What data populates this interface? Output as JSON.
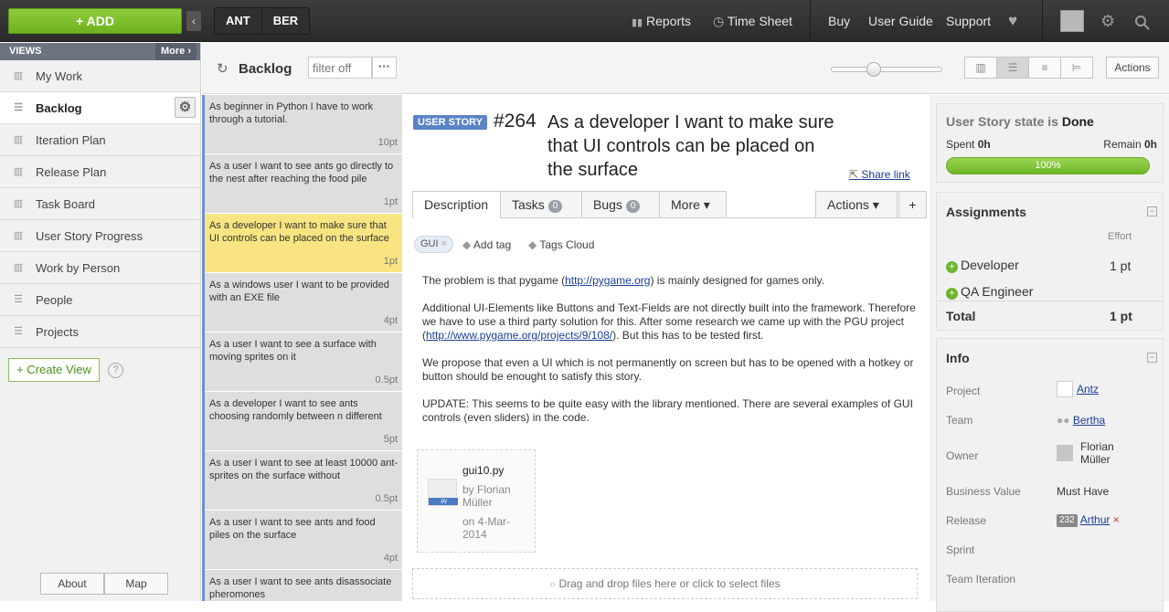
{
  "topbar": {
    "add_label": "+ ADD",
    "teams": [
      "ANT",
      "BER"
    ],
    "nav": {
      "reports": "Reports",
      "timesheet": "Time Sheet",
      "buy": "Buy",
      "user_guide": "User Guide",
      "support": "Support"
    }
  },
  "sidebar": {
    "views_label": "VIEWS",
    "more_label": "More ›",
    "items": [
      {
        "label": "My Work"
      },
      {
        "label": "Backlog"
      },
      {
        "label": "Iteration Plan"
      },
      {
        "label": "Release Plan"
      },
      {
        "label": "Task Board"
      },
      {
        "label": "User Story Progress"
      },
      {
        "label": "Work by Person"
      },
      {
        "label": "People"
      },
      {
        "label": "Projects"
      }
    ],
    "create_view": "+ Create View",
    "help": "?",
    "about": "About",
    "map": "Map"
  },
  "toolbar": {
    "title": "Backlog",
    "filter_placeholder": "filter off",
    "filter_more": "···",
    "actions": "Actions",
    "zoom_level": 0.36
  },
  "cards": [
    {
      "text": "As beginner in Python I have to work through a tutorial.",
      "pt": "10pt"
    },
    {
      "text": "As a user I want to see ants go directly to the nest after reaching the food pile",
      "pt": "1pt"
    },
    {
      "text": "As a developer I want to make sure that UI controls can be placed on the surface",
      "pt": "1pt"
    },
    {
      "text": "As a windows user I want to be provided with an EXE file",
      "pt": "4pt"
    },
    {
      "text": "As a user I want to see a surface with moving sprites on it",
      "pt": "0.5pt"
    },
    {
      "text": "As a developer I want to see ants choosing randomly between n different",
      "pt": "5pt"
    },
    {
      "text": "As a user I want to see at least 10000 ant-sprites on the surface without",
      "pt": "0.5pt"
    },
    {
      "text": "As a user I want to see ants and food piles on the surface",
      "pt": "4pt"
    },
    {
      "text": "As a user I want to see ants disassociate pheromones",
      "pt": ""
    }
  ],
  "story": {
    "type": "USER STORY",
    "id": "#264",
    "title": "As a developer I want to make sure that UI controls can be placed on the surface",
    "share": "Share link",
    "tabs": {
      "description": "Description",
      "tasks": "Tasks",
      "tasks_count": "0",
      "bugs": "Bugs",
      "bugs_count": "0",
      "more": "More ▾",
      "actions": "Actions ▾",
      "plus": "+"
    },
    "tag": "GUI",
    "tag_remove": "×",
    "add_tag": "Add tag",
    "tags_cloud": "Tags Cloud",
    "desc": {
      "p1a": "The problem is that pygame (",
      "p1link": "http://pygame.org",
      "p1b": ") is mainly designed for games only.",
      "p2a": "Additional UI-Elements like Buttons and Text-Fields are not directly built into the framework. Therefore we have to use a third party solution for this. After some research we came up with the PGU project (",
      "p2link": "http://www.pygame.org/projects/9/108/",
      "p2b": "). But this has to be tested first.",
      "p3": "We propose that even a UI which is not permanently on screen but has to be opened with a hotkey or button should be enought to satisfy this story.",
      "p4": "UPDATE: This seems to be quite easy with the library mentioned. There are several examples of GUI controls (even sliders) in the code."
    },
    "attachment": {
      "name": "gui10.py",
      "ext": ".py",
      "by": "by Florian Müller",
      "date": "on 4-Mar-2014"
    },
    "dropzone": "Drag and drop files here or click to select files"
  },
  "right": {
    "state_prefix": "User Story state is",
    "state": "Done",
    "spent_label": "Spent",
    "spent": "0h",
    "remain_label": "Remain",
    "remain": "0h",
    "progress": "100%",
    "assignments": {
      "title": "Assignments",
      "effort_header": "Effort",
      "roles": [
        {
          "role": "Developer",
          "effort": "1 pt"
        },
        {
          "role": "QA Engineer",
          "effort": ""
        }
      ],
      "total_label": "Total",
      "total": "1 pt"
    },
    "info": {
      "title": "Info",
      "project_label": "Project",
      "project": "Antz",
      "team_label": "Team",
      "team": "Bertha",
      "owner_label": "Owner",
      "owner": "Florian Müller",
      "bv_label": "Business Value",
      "bv": "Must Have",
      "release_label": "Release",
      "release_id": "232",
      "release": "Arthur",
      "release_remove": "×",
      "sprint_label": "Sprint",
      "iteration_label": "Team Iteration"
    }
  },
  "colors": {
    "accent_green": "#7abf2a",
    "story_blue": "#5b83c6",
    "selected_card": "#f8e581"
  }
}
